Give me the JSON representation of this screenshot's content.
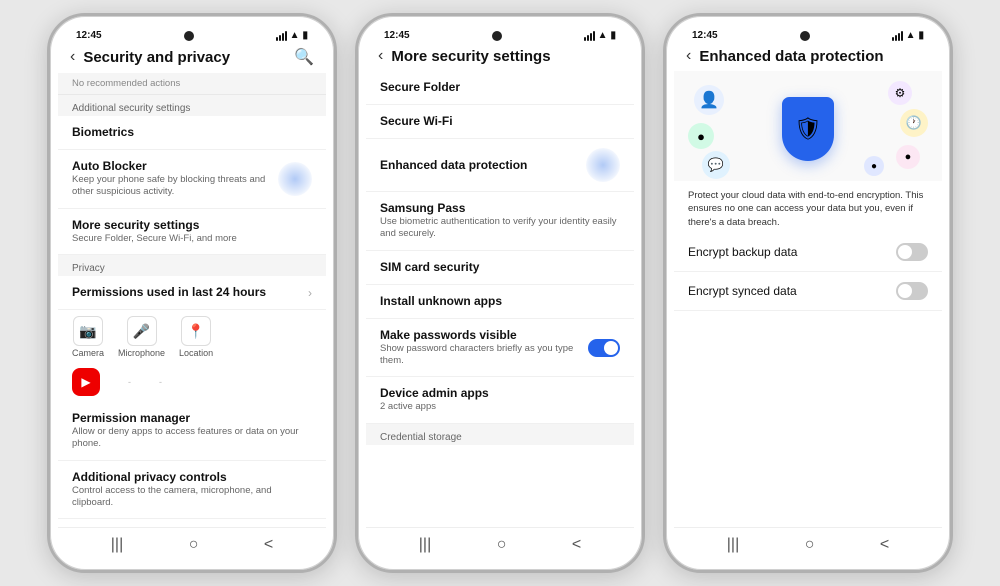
{
  "phones": [
    {
      "id": "phone1",
      "statusTime": "12:45",
      "title": "Security and privacy",
      "searchIcon": "🔍",
      "noticeText": "No recommended actions",
      "sections": [
        {
          "label": "Additional security settings",
          "items": [
            {
              "title": "Biometrics",
              "subtitle": "",
              "hasChevron": false,
              "hasToggle": false,
              "hasRipple": false
            },
            {
              "title": "Auto Blocker",
              "subtitle": "Keep your phone safe by blocking threats and other suspicious activity.",
              "hasChevron": false,
              "hasToggle": false,
              "hasRipple": true
            },
            {
              "title": "More security settings",
              "subtitle": "Secure Folder, Secure Wi-Fi, and more",
              "hasChevron": false,
              "hasToggle": false,
              "hasRipple": false
            }
          ]
        },
        {
          "label": "Privacy",
          "items": [
            {
              "title": "Permissions used in last 24 hours",
              "subtitle": "",
              "hasChevron": true,
              "hasToggle": false,
              "hasRipple": false
            }
          ]
        },
        {
          "label": "",
          "items": [
            {
              "title": "Permission manager",
              "subtitle": "Allow or deny apps to access features or data on your phone.",
              "hasChevron": false,
              "hasToggle": false,
              "hasRipple": false
            },
            {
              "title": "Additional privacy controls",
              "subtitle": "Control access to the camera, microphone, and clipboard.",
              "hasChevron": false,
              "hasToggle": false,
              "hasRipple": false
            }
          ]
        }
      ],
      "permIcons": [
        "📷",
        "🎤",
        "📍"
      ],
      "permLabels": [
        "Camera",
        "Microphone",
        "Location"
      ]
    },
    {
      "id": "phone2",
      "statusTime": "12:45",
      "title": "More security settings",
      "items": [
        {
          "title": "Secure Folder",
          "subtitle": "",
          "hasToggle": false,
          "hasChevron": false
        },
        {
          "title": "Secure Wi-Fi",
          "subtitle": "",
          "hasToggle": false,
          "hasChevron": false
        },
        {
          "title": "Enhanced data protection",
          "subtitle": "",
          "hasToggle": false,
          "hasChevron": false,
          "hasRipple": true
        },
        {
          "title": "Samsung Pass",
          "subtitle": "Use biometric authentication to verify your identity easily and securely.",
          "hasToggle": false,
          "hasChevron": false
        },
        {
          "title": "SIM card security",
          "subtitle": "",
          "hasToggle": false,
          "hasChevron": false
        },
        {
          "title": "Install unknown apps",
          "subtitle": "",
          "hasToggle": false,
          "hasChevron": false
        },
        {
          "title": "Make passwords visible",
          "subtitle": "Show password characters briefly as you type them.",
          "hasToggle": true,
          "toggleOn": true,
          "hasChevron": false
        },
        {
          "title": "Device admin apps",
          "subtitle": "2 active apps",
          "hasToggle": false,
          "hasChevron": false
        }
      ],
      "sectionLabel": "Credential storage"
    },
    {
      "id": "phone3",
      "statusTime": "12:45",
      "title": "Enhanced data protection",
      "protectText": "Protect your cloud data with end-to-end encryption. This ensures no one can access your data but you, even if there's a data breach.",
      "encryptItems": [
        {
          "label": "Encrypt backup data",
          "on": false
        },
        {
          "label": "Encrypt synced data",
          "on": false
        }
      ]
    }
  ],
  "navButtons": [
    "|||",
    "○",
    "<"
  ]
}
